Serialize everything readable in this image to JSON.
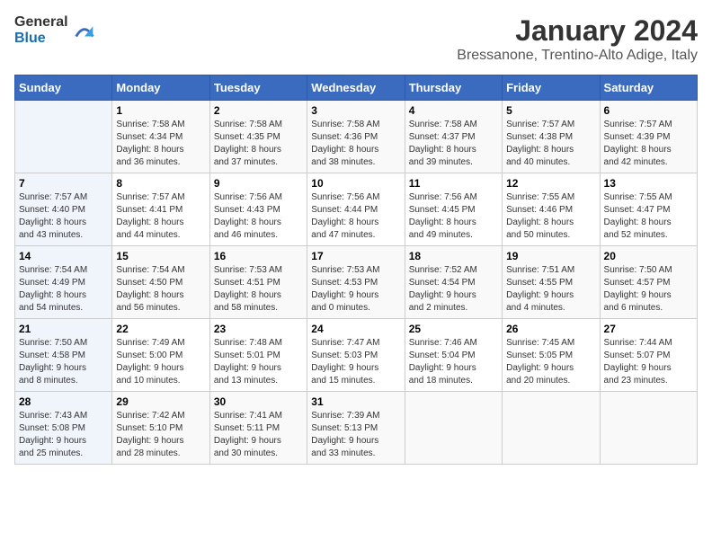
{
  "header": {
    "logo_general": "General",
    "logo_blue": "Blue",
    "title": "January 2024",
    "subtitle": "Bressanone, Trentino-Alto Adige, Italy"
  },
  "columns": [
    "Sunday",
    "Monday",
    "Tuesday",
    "Wednesday",
    "Thursday",
    "Friday",
    "Saturday"
  ],
  "weeks": [
    {
      "days": [
        {
          "number": "",
          "details": []
        },
        {
          "number": "1",
          "details": [
            "Sunrise: 7:58 AM",
            "Sunset: 4:34 PM",
            "Daylight: 8 hours",
            "and 36 minutes."
          ]
        },
        {
          "number": "2",
          "details": [
            "Sunrise: 7:58 AM",
            "Sunset: 4:35 PM",
            "Daylight: 8 hours",
            "and 37 minutes."
          ]
        },
        {
          "number": "3",
          "details": [
            "Sunrise: 7:58 AM",
            "Sunset: 4:36 PM",
            "Daylight: 8 hours",
            "and 38 minutes."
          ]
        },
        {
          "number": "4",
          "details": [
            "Sunrise: 7:58 AM",
            "Sunset: 4:37 PM",
            "Daylight: 8 hours",
            "and 39 minutes."
          ]
        },
        {
          "number": "5",
          "details": [
            "Sunrise: 7:57 AM",
            "Sunset: 4:38 PM",
            "Daylight: 8 hours",
            "and 40 minutes."
          ]
        },
        {
          "number": "6",
          "details": [
            "Sunrise: 7:57 AM",
            "Sunset: 4:39 PM",
            "Daylight: 8 hours",
            "and 42 minutes."
          ]
        }
      ]
    },
    {
      "days": [
        {
          "number": "7",
          "details": [
            "Sunrise: 7:57 AM",
            "Sunset: 4:40 PM",
            "Daylight: 8 hours",
            "and 43 minutes."
          ]
        },
        {
          "number": "8",
          "details": [
            "Sunrise: 7:57 AM",
            "Sunset: 4:41 PM",
            "Daylight: 8 hours",
            "and 44 minutes."
          ]
        },
        {
          "number": "9",
          "details": [
            "Sunrise: 7:56 AM",
            "Sunset: 4:43 PM",
            "Daylight: 8 hours",
            "and 46 minutes."
          ]
        },
        {
          "number": "10",
          "details": [
            "Sunrise: 7:56 AM",
            "Sunset: 4:44 PM",
            "Daylight: 8 hours",
            "and 47 minutes."
          ]
        },
        {
          "number": "11",
          "details": [
            "Sunrise: 7:56 AM",
            "Sunset: 4:45 PM",
            "Daylight: 8 hours",
            "and 49 minutes."
          ]
        },
        {
          "number": "12",
          "details": [
            "Sunrise: 7:55 AM",
            "Sunset: 4:46 PM",
            "Daylight: 8 hours",
            "and 50 minutes."
          ]
        },
        {
          "number": "13",
          "details": [
            "Sunrise: 7:55 AM",
            "Sunset: 4:47 PM",
            "Daylight: 8 hours",
            "and 52 minutes."
          ]
        }
      ]
    },
    {
      "days": [
        {
          "number": "14",
          "details": [
            "Sunrise: 7:54 AM",
            "Sunset: 4:49 PM",
            "Daylight: 8 hours",
            "and 54 minutes."
          ]
        },
        {
          "number": "15",
          "details": [
            "Sunrise: 7:54 AM",
            "Sunset: 4:50 PM",
            "Daylight: 8 hours",
            "and 56 minutes."
          ]
        },
        {
          "number": "16",
          "details": [
            "Sunrise: 7:53 AM",
            "Sunset: 4:51 PM",
            "Daylight: 8 hours",
            "and 58 minutes."
          ]
        },
        {
          "number": "17",
          "details": [
            "Sunrise: 7:53 AM",
            "Sunset: 4:53 PM",
            "Daylight: 9 hours",
            "and 0 minutes."
          ]
        },
        {
          "number": "18",
          "details": [
            "Sunrise: 7:52 AM",
            "Sunset: 4:54 PM",
            "Daylight: 9 hours",
            "and 2 minutes."
          ]
        },
        {
          "number": "19",
          "details": [
            "Sunrise: 7:51 AM",
            "Sunset: 4:55 PM",
            "Daylight: 9 hours",
            "and 4 minutes."
          ]
        },
        {
          "number": "20",
          "details": [
            "Sunrise: 7:50 AM",
            "Sunset: 4:57 PM",
            "Daylight: 9 hours",
            "and 6 minutes."
          ]
        }
      ]
    },
    {
      "days": [
        {
          "number": "21",
          "details": [
            "Sunrise: 7:50 AM",
            "Sunset: 4:58 PM",
            "Daylight: 9 hours",
            "and 8 minutes."
          ]
        },
        {
          "number": "22",
          "details": [
            "Sunrise: 7:49 AM",
            "Sunset: 5:00 PM",
            "Daylight: 9 hours",
            "and 10 minutes."
          ]
        },
        {
          "number": "23",
          "details": [
            "Sunrise: 7:48 AM",
            "Sunset: 5:01 PM",
            "Daylight: 9 hours",
            "and 13 minutes."
          ]
        },
        {
          "number": "24",
          "details": [
            "Sunrise: 7:47 AM",
            "Sunset: 5:03 PM",
            "Daylight: 9 hours",
            "and 15 minutes."
          ]
        },
        {
          "number": "25",
          "details": [
            "Sunrise: 7:46 AM",
            "Sunset: 5:04 PM",
            "Daylight: 9 hours",
            "and 18 minutes."
          ]
        },
        {
          "number": "26",
          "details": [
            "Sunrise: 7:45 AM",
            "Sunset: 5:05 PM",
            "Daylight: 9 hours",
            "and 20 minutes."
          ]
        },
        {
          "number": "27",
          "details": [
            "Sunrise: 7:44 AM",
            "Sunset: 5:07 PM",
            "Daylight: 9 hours",
            "and 23 minutes."
          ]
        }
      ]
    },
    {
      "days": [
        {
          "number": "28",
          "details": [
            "Sunrise: 7:43 AM",
            "Sunset: 5:08 PM",
            "Daylight: 9 hours",
            "and 25 minutes."
          ]
        },
        {
          "number": "29",
          "details": [
            "Sunrise: 7:42 AM",
            "Sunset: 5:10 PM",
            "Daylight: 9 hours",
            "and 28 minutes."
          ]
        },
        {
          "number": "30",
          "details": [
            "Sunrise: 7:41 AM",
            "Sunset: 5:11 PM",
            "Daylight: 9 hours",
            "and 30 minutes."
          ]
        },
        {
          "number": "31",
          "details": [
            "Sunrise: 7:39 AM",
            "Sunset: 5:13 PM",
            "Daylight: 9 hours",
            "and 33 minutes."
          ]
        },
        {
          "number": "",
          "details": []
        },
        {
          "number": "",
          "details": []
        },
        {
          "number": "",
          "details": []
        }
      ]
    }
  ]
}
